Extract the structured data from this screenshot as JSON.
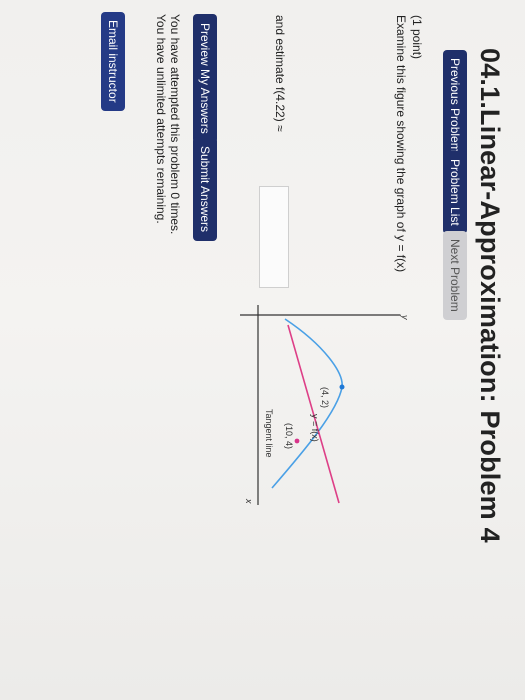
{
  "page": {
    "title": "04.1.Linear-Approximation: Problem 4"
  },
  "nav": {
    "previous": "Previous Problem",
    "list": "Problem List",
    "next": "Next Problem"
  },
  "problem": {
    "points": "(1 point)",
    "prompt": "Examine this figure showing the graph of y = f(x)",
    "estimate": "and estimate f(4.22) ≈"
  },
  "figure": {
    "axis_y_label": "y",
    "axis_x_label": "x",
    "curve_label": "y = f(x)",
    "point_a_label": "(10, 4)",
    "point_b_label": "(4, 2)",
    "tangent_label": "Tangent line",
    "colors": {
      "curve": "#4aa0e6",
      "tangent": "#dd3f87",
      "point": "#1f79d6",
      "point2": "#d8348a"
    }
  },
  "actions": {
    "preview": "Preview My Answers",
    "submit": "Submit Answers"
  },
  "status": {
    "attempted": "You have attempted this problem 0 times.",
    "remaining": "You have unlimited attempts remaining."
  },
  "footer": {
    "email": "Email instructor"
  }
}
